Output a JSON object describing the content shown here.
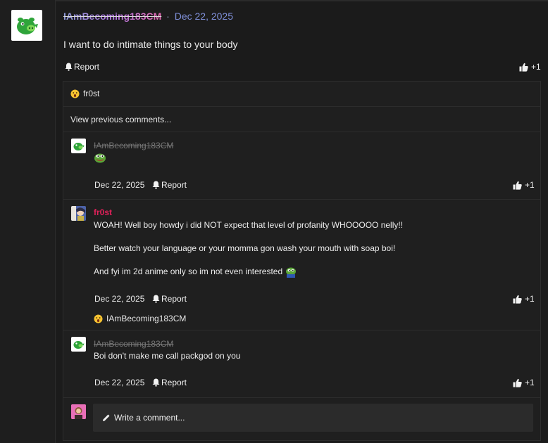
{
  "post": {
    "username": "IAmBecoming183CM",
    "separator": "·",
    "date": "Dec 22, 2025",
    "body": "I want to do intimate things to your body",
    "report_label": "Report",
    "like_count": "+1"
  },
  "comments_section": {
    "top_reaction_user": "fr0st",
    "view_previous": "View previous comments...",
    "comments": [
      {
        "author": "IAmBecoming183CM",
        "date": "Dec 22, 2025",
        "report_label": "Report",
        "like_count": "+1"
      },
      {
        "author": "fr0st",
        "lines": [
          "WOAH! Well boy howdy i did NOT expect that level of profanity WHOOOOO nelly!!",
          "Better watch your language or your momma gon wash your mouth with soap boi!",
          "And fyi im 2d anime only so im not even interested"
        ],
        "date": "Dec 22, 2025",
        "report_label": "Report",
        "like_count": "+1",
        "reaction_user": "IAmBecoming183CM"
      },
      {
        "author": "IAmBecoming183CM",
        "text": "Boi don't make me call packgod on you",
        "date": "Dec 22, 2025",
        "report_label": "Report",
        "like_count": "+1"
      }
    ],
    "write_placeholder": "Write a comment..."
  },
  "colors": {
    "background": "#1b1b1b",
    "panel": "#1f1f1f",
    "accent_pink": "#e0215a",
    "date_blue": "#7f8fd8"
  },
  "icons": [
    "green-pig-avatar-icon",
    "bell-icon",
    "thumbs-up-icon",
    "surprised-emoji-icon",
    "pepe-emoji-icon",
    "pencil-icon"
  ]
}
